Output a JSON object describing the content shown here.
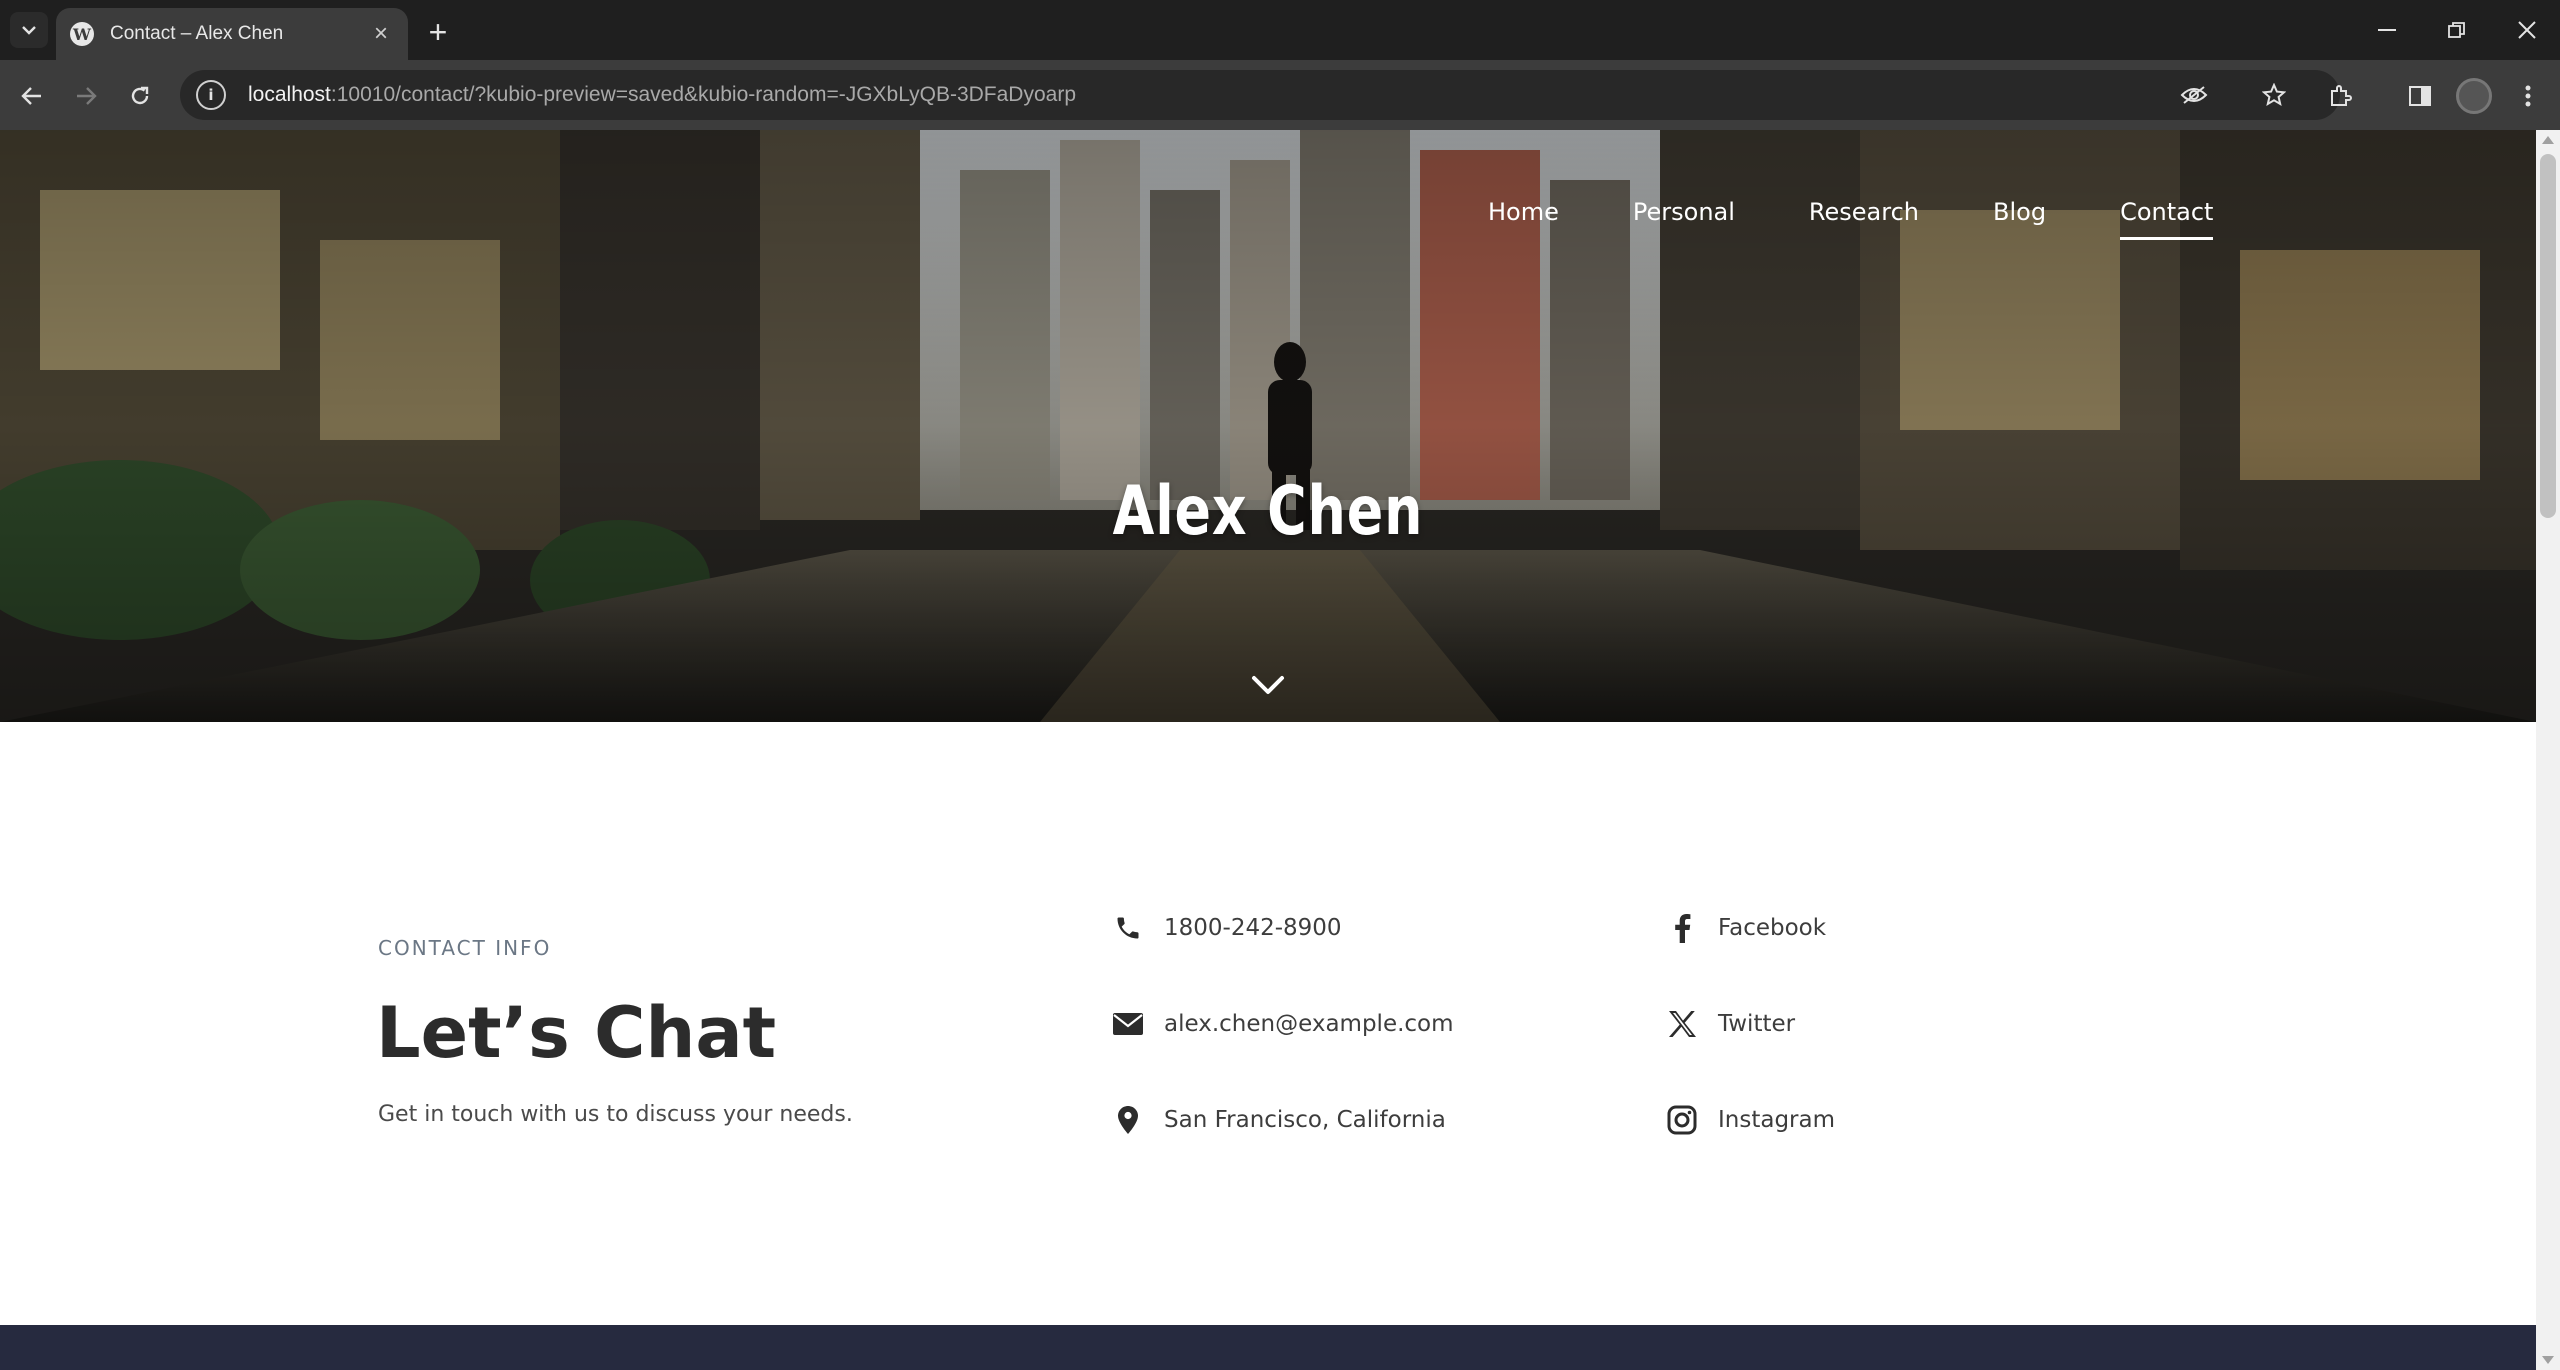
{
  "browser": {
    "tab_title": "Contact – Alex Chen",
    "favicon_glyph": "W",
    "url_host": "localhost",
    "url_rest": ":10010/contact/?kubio-preview=saved&kubio-random=-JGXbLyQB-3DFaDyoarp"
  },
  "nav": {
    "items": [
      "Home",
      "Personal",
      "Research",
      "Blog",
      "Contact"
    ],
    "active": "Contact"
  },
  "hero": {
    "title": "Alex Chen"
  },
  "contact": {
    "kicker": "CONTACT INFO",
    "headline": "Let’s Chat",
    "subtext": "Get in touch with us to discuss your needs.",
    "phone": "1800-242-8900",
    "email": "alex.chen@example.com",
    "location": "San Francisco, California"
  },
  "social": {
    "facebook": "Facebook",
    "twitter": "Twitter",
    "instagram": "Instagram"
  },
  "colors": {
    "footer": "#262a3f",
    "heading": "#2c2c2c",
    "kicker": "#6b7785"
  }
}
